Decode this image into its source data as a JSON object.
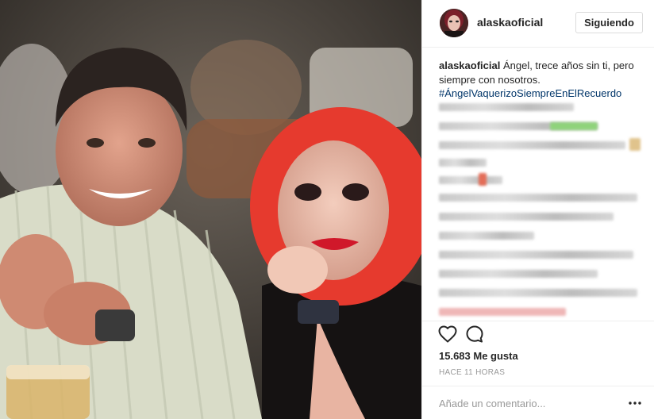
{
  "post": {
    "username": "alaskaoficial",
    "follow_button": "Siguiendo",
    "caption": {
      "username": "alaskaoficial",
      "text": "Ángel, trece años sin ti, pero siempre con nosotros.",
      "hashtag": "#ÁngelVaquerizoSiempreEnElRecuerdo"
    },
    "likes": "15.683 Me gusta",
    "timestamp": "HACE 11 HORAS",
    "comment_placeholder": "Añade un comentario...",
    "icons": [
      "heart-icon",
      "comment-icon",
      "more-options-icon"
    ]
  },
  "colors": {
    "hashtag": "#003569",
    "border": "#efefef",
    "muted": "#999999"
  }
}
